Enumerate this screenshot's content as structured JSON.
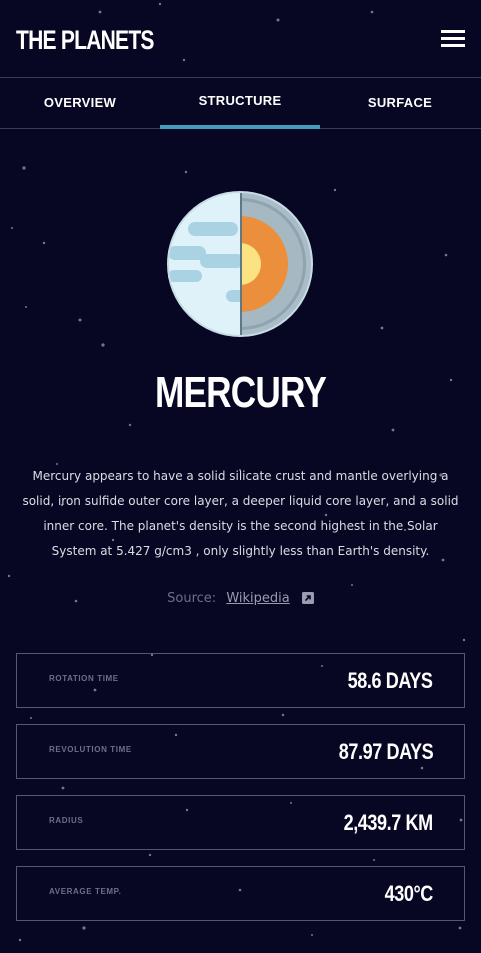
{
  "app": {
    "title": "THE PLANETS"
  },
  "tabs": [
    {
      "label": "OVERVIEW"
    },
    {
      "label": "STRUCTURE"
    },
    {
      "label": "SURFACE"
    }
  ],
  "active_tab": "STRUCTURE",
  "planet": {
    "name": "MERCURY",
    "description": "Mercury appears to have a solid silicate crust and mantle overlying a solid, iron sulfide outer core layer, a deeper liquid core layer, and a solid inner core. The planet's density is the second highest in the Solar System at 5.427 g/cm3 , only slightly less than Earth's density.",
    "source_label": "Source:",
    "source_link": "Wikipedia"
  },
  "stats": [
    {
      "label": "ROTATION TIME",
      "value": "58.6 DAYS"
    },
    {
      "label": "REVOLUTION TIME",
      "value": "87.97 DAYS"
    },
    {
      "label": "RADIUS",
      "value": "2,439.7 KM"
    },
    {
      "label": "AVERAGE TEMP.",
      "value": "430°C"
    }
  ],
  "colors": {
    "background": "#070724",
    "accent": "#419ebb",
    "border": "#565670"
  },
  "icons": {
    "menu": "hamburger-menu-icon",
    "external": "external-link-icon"
  }
}
